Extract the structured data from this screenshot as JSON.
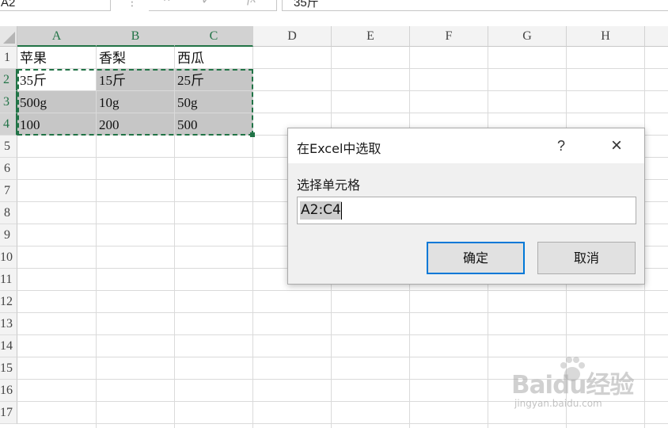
{
  "formula_bar": {
    "name_box": "A2",
    "dots": "⋮",
    "cancel_icon": "×",
    "enter_icon": "✓",
    "fx_icon": "fx",
    "formula_value": "35斤"
  },
  "sheet": {
    "columns": [
      "A",
      "B",
      "C",
      "D",
      "E",
      "F",
      "G",
      "H"
    ],
    "rows": [
      "1",
      "2",
      "3",
      "4",
      "5",
      "6",
      "7",
      "8",
      "9",
      "10",
      "11",
      "12",
      "13",
      "14",
      "15",
      "16",
      "17"
    ],
    "cells": {
      "A1": "苹果",
      "B1": "香梨",
      "C1": "西瓜",
      "A2": "35斤",
      "B2": "15斤",
      "C2": "25斤",
      "A3": "500g",
      "B3": "10g",
      "C3": "50g",
      "A4": "100",
      "B4": "200",
      "C4": "500"
    },
    "selection": "A2:C4",
    "selection_color": "#217346"
  },
  "dialog": {
    "title": "在Excel中选取",
    "help": "?",
    "close": "×",
    "field_label": "选择单元格",
    "range_value": "A2:C4",
    "ok_label": "确定",
    "cancel_label": "取消",
    "accent_color": "#0078d7"
  },
  "watermark": {
    "main": "Baidu经验",
    "sub": "jingyan.baidu.com"
  }
}
